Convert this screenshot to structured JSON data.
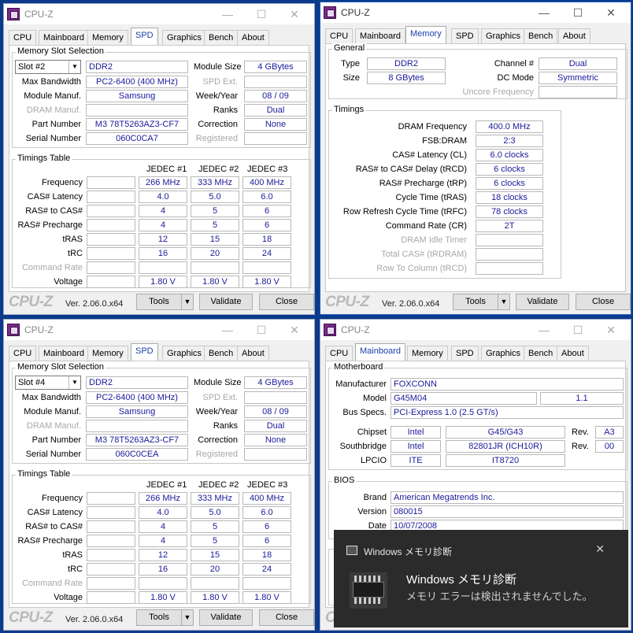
{
  "app_title": "CPU-Z",
  "tabs": [
    "CPU",
    "Mainboard",
    "Memory",
    "SPD",
    "Graphics",
    "Bench",
    "About"
  ],
  "footer": {
    "logo": "CPU-Z",
    "version": "Ver. 2.06.0.x64",
    "tools": "Tools",
    "validate": "Validate",
    "close": "Close"
  },
  "spd_labels": {
    "group_slot": "Memory Slot Selection",
    "max_bandwidth": "Max Bandwidth",
    "module_manuf": "Module Manuf.",
    "dram_manuf": "DRAM Manuf.",
    "part_number": "Part Number",
    "serial_number": "Serial Number",
    "module_size": "Module Size",
    "spd_ext": "SPD Ext.",
    "week_year": "Week/Year",
    "ranks": "Ranks",
    "correction": "Correction",
    "registered": "Registered",
    "group_timings": "Timings Table",
    "frequency": "Frequency",
    "cas_latency": "CAS# Latency",
    "ras_to_cas": "RAS# to CAS#",
    "ras_precharge": "RAS# Precharge",
    "tras": "tRAS",
    "trc": "tRC",
    "command_rate": "Command Rate",
    "voltage": "Voltage"
  },
  "spd_slot2": {
    "slot": "Slot #2",
    "type": "DDR2",
    "module_size": "4 GBytes",
    "max_bandwidth": "PC2-6400 (400 MHz)",
    "module_manuf": "Samsung",
    "week_year": "08 / 09",
    "ranks": "Dual",
    "part_number": "M3 78T5263AZ3-CF7",
    "correction": "None",
    "serial_number": "060C0CA7",
    "jedec_headers": [
      "JEDEC #1",
      "JEDEC #2",
      "JEDEC #3"
    ],
    "frequency": [
      "266 MHz",
      "333 MHz",
      "400 MHz"
    ],
    "cas": [
      "4.0",
      "5.0",
      "6.0"
    ],
    "ras_to_cas": [
      "4",
      "5",
      "6"
    ],
    "ras_precharge": [
      "4",
      "5",
      "6"
    ],
    "tras": [
      "12",
      "15",
      "18"
    ],
    "trc": [
      "16",
      "20",
      "24"
    ],
    "voltage": [
      "1.80 V",
      "1.80 V",
      "1.80 V"
    ]
  },
  "spd_slot4": {
    "slot": "Slot #4",
    "type": "DDR2",
    "module_size": "4 GBytes",
    "max_bandwidth": "PC2-6400 (400 MHz)",
    "module_manuf": "Samsung",
    "week_year": "08 / 09",
    "ranks": "Dual",
    "part_number": "M3 78T5263AZ3-CF7",
    "correction": "None",
    "serial_number": "060C0CEA",
    "jedec_headers": [
      "JEDEC #1",
      "JEDEC #2",
      "JEDEC #3"
    ],
    "frequency": [
      "266 MHz",
      "333 MHz",
      "400 MHz"
    ],
    "cas": [
      "4.0",
      "5.0",
      "6.0"
    ],
    "ras_to_cas": [
      "4",
      "5",
      "6"
    ],
    "ras_precharge": [
      "4",
      "5",
      "6"
    ],
    "tras": [
      "12",
      "15",
      "18"
    ],
    "trc": [
      "16",
      "20",
      "24"
    ],
    "voltage": [
      "1.80 V",
      "1.80 V",
      "1.80 V"
    ]
  },
  "memory": {
    "group_general": "General",
    "type_label": "Type",
    "type": "DDR2",
    "size_label": "Size",
    "size": "8 GBytes",
    "channel_label": "Channel #",
    "channel": "Dual",
    "dc_mode_label": "DC Mode",
    "dc_mode": "Symmetric",
    "uncore_label": "Uncore Frequency",
    "group_timings": "Timings",
    "dram_freq_label": "DRAM Frequency",
    "dram_freq": "400.0 MHz",
    "fsb_dram_label": "FSB:DRAM",
    "fsb_dram": "2:3",
    "cas_label": "CAS# Latency (CL)",
    "cas": "6.0 clocks",
    "trcd_label": "RAS# to CAS# Delay (tRCD)",
    "trcd": "6 clocks",
    "trp_label": "RAS# Precharge (tRP)",
    "trp": "6 clocks",
    "tras_label": "Cycle Time (tRAS)",
    "tras": "18 clocks",
    "trfc_label": "Row Refresh Cycle Time (tRFC)",
    "trfc": "78 clocks",
    "cr_label": "Command Rate (CR)",
    "cr": "2T",
    "idle_label": "DRAM Idle Timer",
    "trdram_label": "Total CAS# (tRDRAM)",
    "trcd2_label": "Row To Column (tRCD)"
  },
  "mainboard": {
    "group_motherboard": "Motherboard",
    "manufacturer_label": "Manufacturer",
    "manufacturer": "FOXCONN",
    "model_label": "Model",
    "model": "G45M04",
    "model_rev": "1.1",
    "bus_label": "Bus Specs.",
    "bus": "PCI-Express 1.0 (2.5 GT/s)",
    "chipset_label": "Chipset",
    "chipset_vendor": "Intel",
    "chipset": "G45/G43",
    "chipset_rev_label": "Rev.",
    "chipset_rev": "A3",
    "southbridge_label": "Southbridge",
    "southbridge_vendor": "Intel",
    "southbridge": "82801JR (ICH10R)",
    "southbridge_rev_label": "Rev.",
    "southbridge_rev": "00",
    "lpcio_label": "LPCIO",
    "lpcio_vendor": "ITE",
    "lpcio": "IT8720",
    "group_bios": "BIOS",
    "brand_label": "Brand",
    "brand": "American Megatrends Inc.",
    "version_label": "Version",
    "version": "080015",
    "date_label": "Date",
    "date": "10/07/2008"
  },
  "toast": {
    "app": "Windows メモリ診断",
    "title": "Windows メモリ診断",
    "message": "メモリ エラーは検出されませんでした。"
  }
}
